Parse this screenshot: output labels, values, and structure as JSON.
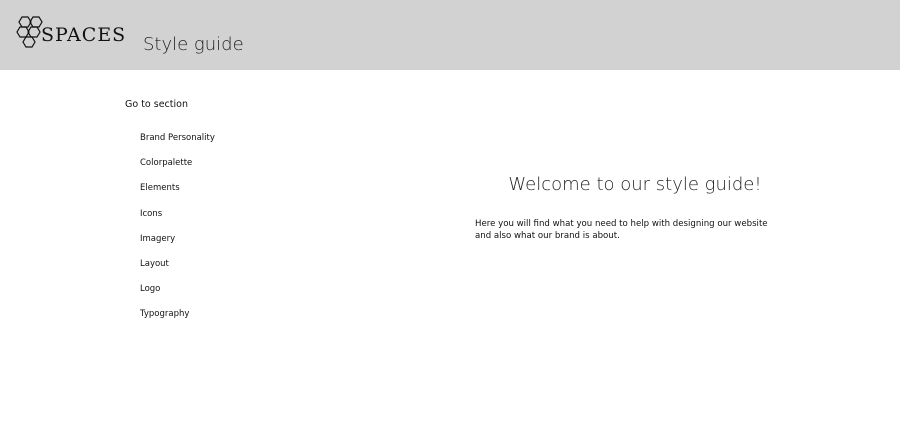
{
  "header": {
    "logo_text": "SPACES",
    "title": "Style guide",
    "background": "#d2d2d2"
  },
  "sidebar": {
    "heading": "Go to section",
    "items": [
      {
        "label": "Brand Personality"
      },
      {
        "label": "Colorpalette"
      },
      {
        "label": "Elements"
      },
      {
        "label": "Icons"
      },
      {
        "label": "Imagery"
      },
      {
        "label": "Layout"
      },
      {
        "label": "Logo"
      },
      {
        "label": "Typography"
      }
    ]
  },
  "main": {
    "heading": "Welcome to our style guide!",
    "intro": "Here you will find what you need to help with designing our website and also what our brand is about."
  },
  "icons": {
    "logo": "hexagon-cluster-icon"
  }
}
